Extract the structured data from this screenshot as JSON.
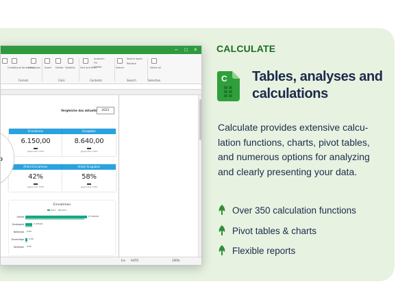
{
  "section_label": "CALCULATE",
  "headline": "Tables, analyses and calculations",
  "description": "Calculate provides extensive calculation functions, charts, pivot tables, and numerous options for analyzing and clearly presenting your data.",
  "description_display": "Calculate provides extensive calcu-lation functions, charts, pivot tables, and numerous options for analyzing and clearly presenting your data.",
  "features": [
    "Over 350 calculation functions",
    "Pivot tables & charts",
    "Flexible reports"
  ],
  "icons": {
    "app": "calculate-app-icon",
    "feature_bullet": "leaf-icon"
  },
  "colors": {
    "brand_green": "#1d6b1f",
    "card_bg": "#e7f2e1",
    "title_bar": "#2e9a3e",
    "kpi_header": "#29a3e0",
    "bar": "#17a687"
  },
  "window": {
    "ribbon_groups": [
      "Format",
      "Cells",
      "Contents",
      "Search",
      "Selection"
    ],
    "ribbon_items": [
      "Conditional formatting",
      "Cell styles",
      "Insert",
      "Delete",
      "Visibility",
      "Sort and filter",
      "Autosum",
      "Fill",
      "Delete",
      "Search",
      "Search again",
      "Replace",
      "Select all"
    ],
    "compare_label": "Vergleiche das aktuelle Jahr mit",
    "compare_year": "2021",
    "kpis": [
      {
        "header": "Einnahmen",
        "value": "6.150,00",
        "sub": "gegenüber 2022"
      },
      {
        "header": "Ausgaben",
        "value": "8.640,00",
        "sub": "gegenüber 2022"
      },
      {
        "header": "Anteil Einnahmen",
        "value": "42%",
        "sub": "gegenüber 2022"
      },
      {
        "header": "Anteil Ausgaben",
        "value": "58%",
        "sub": "gegenüber 2022"
      }
    ],
    "gauge_text": "0",
    "chart": {
      "title": "Einnahmen",
      "legend": [
        "2017",
        "2021"
      ],
      "rows": [
        {
          "label": "Gehalt",
          "value": "27.000,00",
          "frac": 0.9
        },
        {
          "label": "Kindergeld",
          "value": "2.376,00",
          "frac": 0.1
        },
        {
          "label": "Nebenjob",
          "value": "0,00",
          "frac": 0.0
        },
        {
          "label": "Zinserträge",
          "value": "0,00",
          "frac": 0.03
        },
        {
          "label": "Sonstiges",
          "value": "0,00",
          "frac": 0.0
        }
      ]
    },
    "status": {
      "mode": "Ins",
      "calc": "AUTO",
      "zoom": "100%"
    }
  }
}
